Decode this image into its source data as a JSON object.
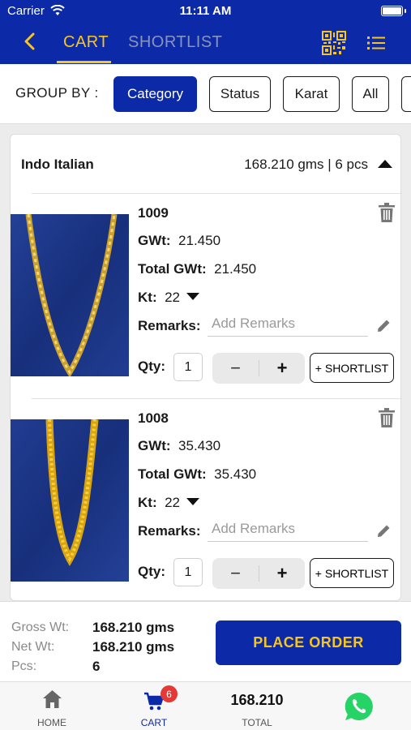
{
  "status_bar": {
    "carrier": "Carrier",
    "time": "11:11 AM"
  },
  "header": {
    "tabs": [
      {
        "label": "CART",
        "active": true
      },
      {
        "label": "SHORTLIST",
        "active": false
      }
    ],
    "icons": [
      "back-arrow-icon",
      "qr-code-icon",
      "list-menu-icon"
    ]
  },
  "group_by": {
    "label": "GROUP BY :",
    "options": [
      "Category",
      "Status",
      "Karat",
      "All"
    ],
    "selected": "Category"
  },
  "group": {
    "name": "Indo Italian",
    "summary": "168.210 gms | 6 pcs",
    "items": [
      {
        "code": "1009",
        "gwt_label": "GWt:",
        "gwt": "21.450",
        "total_gwt_label": "Total GWt:",
        "total_gwt": "21.450",
        "kt_label": "Kt:",
        "kt": "22",
        "remarks_label": "Remarks:",
        "remarks_placeholder": "Add Remarks",
        "qty_label": "Qty:",
        "qty": "1",
        "minus": "−",
        "plus": "+",
        "shortlist_label": "+ SHORTLIST"
      },
      {
        "code": "1008",
        "gwt_label": "GWt:",
        "gwt": "35.430",
        "total_gwt_label": "Total GWt:",
        "total_gwt": "35.430",
        "kt_label": "Kt:",
        "kt": "22",
        "remarks_label": "Remarks:",
        "remarks_placeholder": "Add Remarks",
        "qty_label": "Qty:",
        "qty": "1",
        "minus": "−",
        "plus": "+",
        "shortlist_label": "+ SHORTLIST"
      }
    ]
  },
  "summary": {
    "gross_label": "Gross Wt:",
    "gross": "168.210 gms",
    "net_label": "Net Wt:",
    "net": "168.210 gms",
    "pcs_label": "Pcs:",
    "pcs": "6",
    "place_order": "PLACE ORDER"
  },
  "tabbar": {
    "home": "HOME",
    "cart": "CART",
    "cart_badge": "6",
    "total_value": "168.210",
    "total": "TOTAL"
  },
  "colors": {
    "brand": "#0c2aa8",
    "accent": "#f7c51b",
    "badge": "#e53935",
    "whatsapp": "#25d366"
  }
}
